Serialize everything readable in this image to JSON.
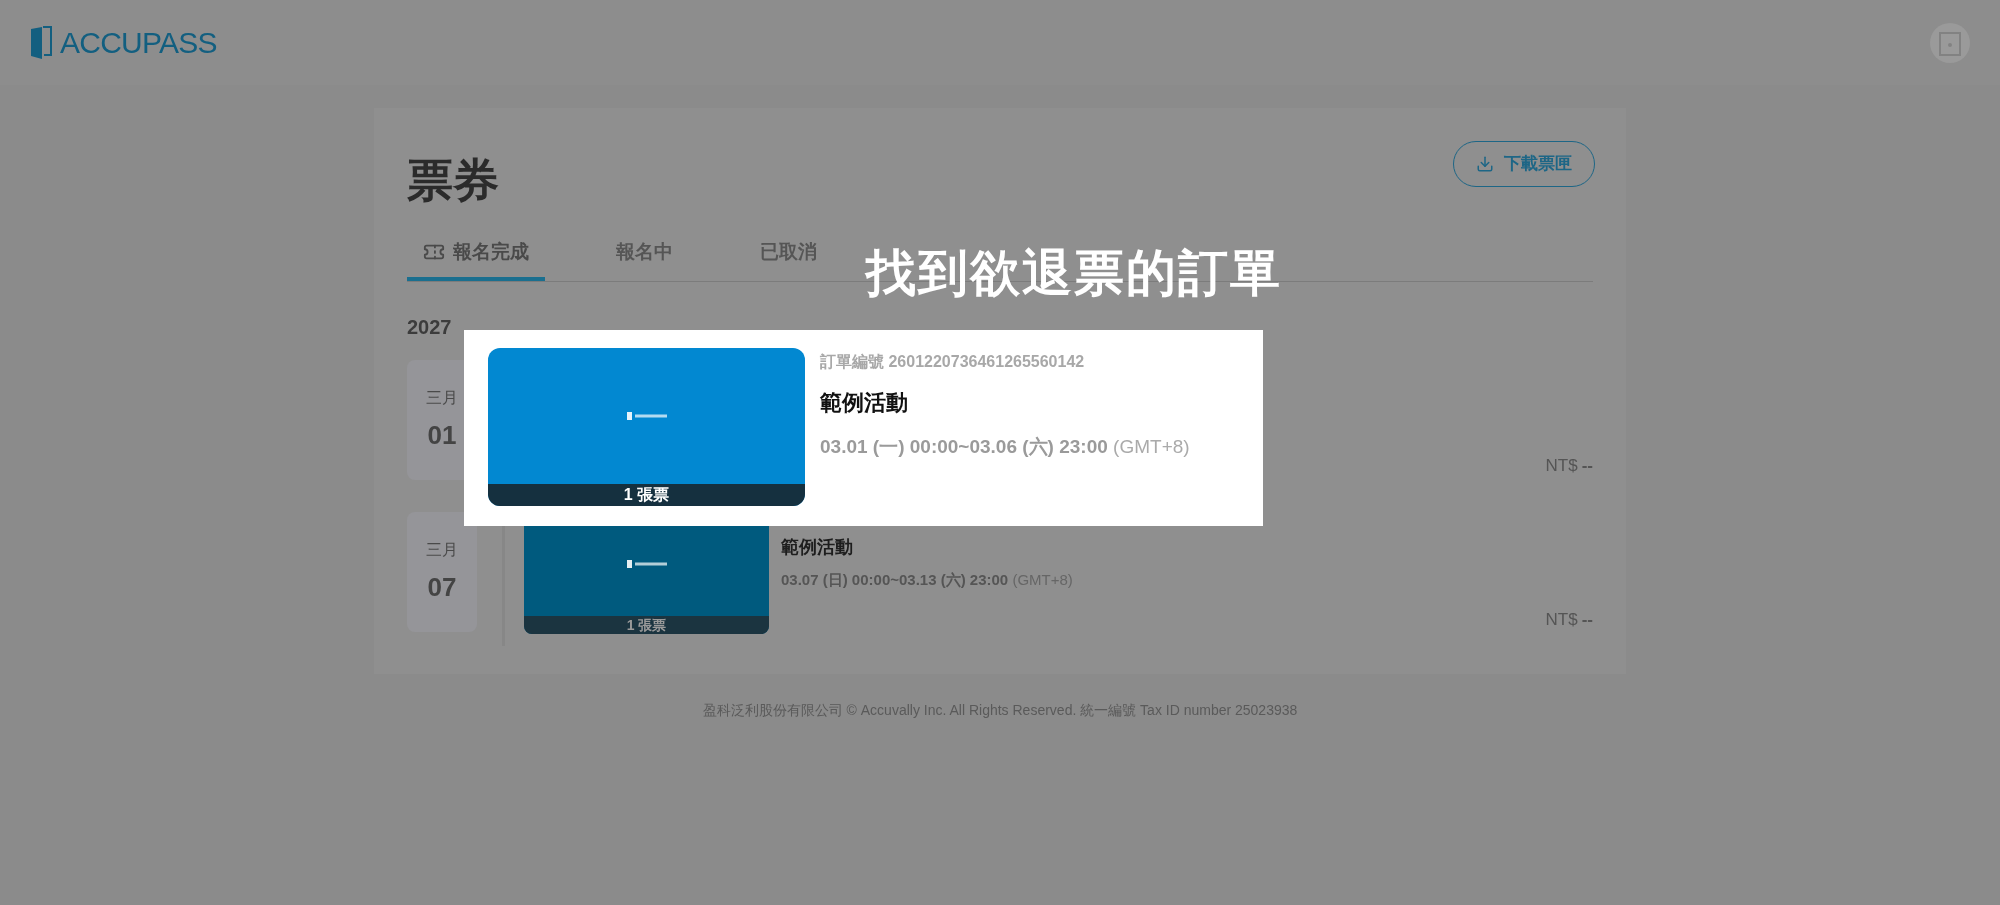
{
  "header": {
    "logo": "ACCUPASS"
  },
  "page": {
    "title": "票券",
    "download_button": "下載票匣"
  },
  "tabs": [
    {
      "label": "報名完成",
      "selected": true
    },
    {
      "label": "報名中",
      "selected": false
    },
    {
      "label": "已取消",
      "selected": false
    }
  ],
  "year": "2027",
  "orders": [
    {
      "month": "三月",
      "day": "01",
      "price_label": "NT$",
      "price": "--"
    },
    {
      "month": "三月",
      "day": "07",
      "title": "範例活動",
      "dates": "03.07 (日) 00:00~03.13 (六) 23:00",
      "timezone": "(GMT+8)",
      "tickets": "1 張票",
      "price_label": "NT$",
      "price": "--"
    }
  ],
  "footer": "盈科泛利股份有限公司 © Accuvally Inc. All Rights Reserved. 統一編號 Tax ID number 25023938",
  "overlay": {
    "title": "找到欲退票的訂單",
    "card": {
      "order_number": "訂單編號 2601220736461265560142",
      "title": "範例活動",
      "dates": "03.01 (一) 00:00~03.06 (六) 23:00",
      "timezone": "(GMT+8)",
      "tickets": "1 張票"
    }
  }
}
